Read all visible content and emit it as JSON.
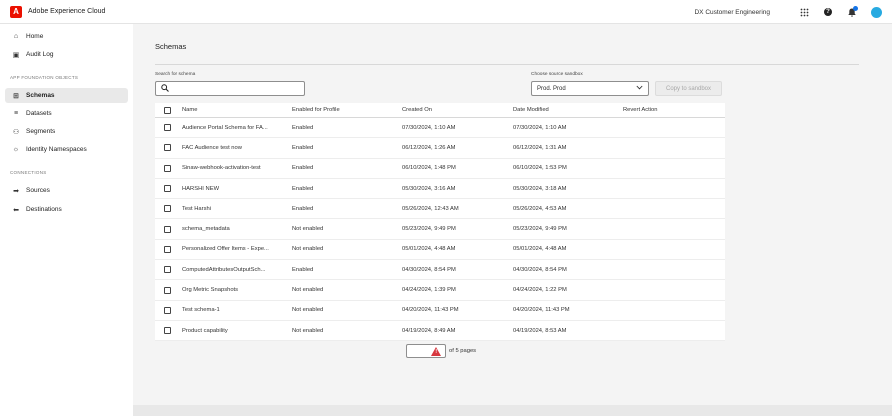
{
  "header": {
    "app_title": "Adobe Experience Cloud",
    "logo_letter": "A",
    "org_name": "DX Customer Engineering",
    "help_glyph": "?"
  },
  "sidebar": {
    "items_top": [
      {
        "label": "Home",
        "icon": "home-icon",
        "glyph": "⌂"
      },
      {
        "label": "Audit Log",
        "icon": "audit-log-icon",
        "glyph": "▣"
      }
    ],
    "section_data": "APP FOUNDATION OBJECTS",
    "items_data": [
      {
        "label": "Schemas",
        "icon": "schema-icon",
        "glyph": "⊞",
        "selected": true
      },
      {
        "label": "Datasets",
        "icon": "dataset-icon",
        "glyph": "≡"
      },
      {
        "label": "Segments",
        "icon": "segments-icon",
        "glyph": "⚇"
      },
      {
        "label": "Identity Namespaces",
        "icon": "identity-icon",
        "glyph": "☼"
      }
    ],
    "section_connections": "CONNECTIONS",
    "items_connections": [
      {
        "label": "Sources",
        "icon": "arrow-right-icon",
        "glyph": "➡"
      },
      {
        "label": "Destinations",
        "icon": "arrow-left-icon",
        "glyph": "⬅"
      }
    ]
  },
  "main": {
    "page_title": "Schemas",
    "search_label": "Search for schema",
    "search_value": "",
    "sandbox_label": "Choose source sandbox",
    "sandbox_value": "Prod. Prod",
    "copy_button": "Copy to sandbox",
    "table": {
      "headers": [
        "Name",
        "Enabled for Profile",
        "Created On",
        "Date Modified",
        "Revert Action"
      ],
      "rows": [
        [
          "Audience Portal Schema for FA...",
          "Enabled",
          "07/30/2024, 1:10 AM",
          "07/30/2024, 1:10 AM",
          ""
        ],
        [
          "FAC Audience test now",
          "Enabled",
          "06/12/2024, 1:26 AM",
          "06/12/2024, 1:31 AM",
          ""
        ],
        [
          "Sinaw-webhook-activation-test",
          "Enabled",
          "06/10/2024, 1:48 PM",
          "06/10/2024, 1:53 PM",
          ""
        ],
        [
          "HARSHI NEW",
          "Enabled",
          "05/30/2024, 3:16 AM",
          "05/30/2024, 3:18 AM",
          ""
        ],
        [
          "Test Harshi",
          "Enabled",
          "05/26/2024, 12:43 AM",
          "05/26/2024, 4:53 AM",
          ""
        ],
        [
          "schema_metadata",
          "Not enabled",
          "05/23/2024, 9:49 PM",
          "05/23/2024, 9:49 PM",
          ""
        ],
        [
          "Personalized Offer Items - Expe...",
          "Not enabled",
          "05/01/2024, 4:48 AM",
          "05/01/2024, 4:48 AM",
          ""
        ],
        [
          "ComputedAttributesOutputSch...",
          "Enabled",
          "04/30/2024, 8:54 PM",
          "04/30/2024, 8:54 PM",
          ""
        ],
        [
          "Org Metric Snapshots",
          "Not enabled",
          "04/24/2024, 1:39 PM",
          "04/24/2024, 1:22 PM",
          ""
        ],
        [
          "Test schema-1",
          "Not enabled",
          "04/20/2024, 11:43 PM",
          "04/20/2024, 11:43 PM",
          ""
        ],
        [
          "Product capability",
          "Not enabled",
          "04/19/2024, 8:49 AM",
          "04/19/2024, 8:53 AM",
          ""
        ]
      ]
    },
    "pager": {
      "page_value": "",
      "suffix": "of 5 pages"
    }
  }
}
